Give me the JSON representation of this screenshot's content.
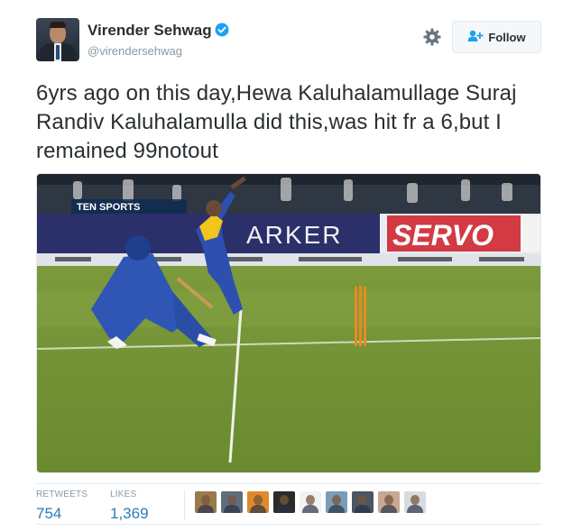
{
  "tweet": {
    "display_name": "Virender Sehwag",
    "handle": "@virendersehwag",
    "verified": true,
    "follow_label": "Follow",
    "text": "6yrs ago on this day,Hewa Kaluhalamullage Suraj Randiv Kaluhalamulla did this,was hit fr a 6,but I remained 99notout"
  },
  "media": {
    "broadcaster_logo": "TEN SPORTS",
    "boards": [
      "ARKER",
      "SERVO"
    ]
  },
  "stats": {
    "retweets_label": "RETWEETS",
    "retweets_value": "754",
    "likes_label": "LIKES",
    "likes_value": "1,369"
  },
  "likers": [
    {
      "name": "liker-avatar-1",
      "color": "#9a7a4e"
    },
    {
      "name": "liker-avatar-2",
      "color": "#5e6d7c"
    },
    {
      "name": "liker-avatar-3",
      "color": "#e08a2a"
    },
    {
      "name": "liker-avatar-4",
      "color": "#2b2b2b"
    },
    {
      "name": "liker-avatar-5",
      "color": "#f2f2f2"
    },
    {
      "name": "liker-avatar-6",
      "color": "#7a9cb8"
    },
    {
      "name": "liker-avatar-7",
      "color": "#4b5563"
    },
    {
      "name": "liker-avatar-8",
      "color": "#c8a894"
    },
    {
      "name": "liker-avatar-9",
      "color": "#d9dbe0"
    }
  ],
  "colors": {
    "link_blue": "#2b7bb9",
    "muted_gray": "#8899a6",
    "text_dark": "#292f33",
    "verified_blue": "#1da1f2"
  }
}
